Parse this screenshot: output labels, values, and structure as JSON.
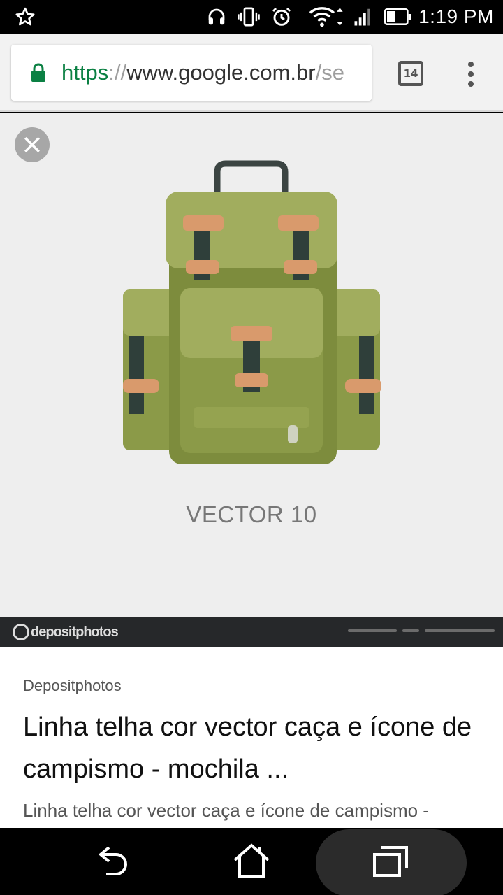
{
  "status_bar": {
    "time": "1:19 PM",
    "icons": [
      "star-icon",
      "headphones-icon",
      "vibrate-icon",
      "alarm-icon",
      "wifi-icon",
      "signal-icon",
      "battery-icon"
    ]
  },
  "toolbar": {
    "url_scheme": "https",
    "url_separator": "://",
    "url_host": "www.google.com.br",
    "url_path": "/se",
    "tab_count": "14"
  },
  "viewer": {
    "image_caption": "VECTOR 10",
    "watermark_brand": "depositphotos"
  },
  "result": {
    "source": "Depositphotos",
    "title": "Linha telha cor vector caça e ícone de campismo - mochila ...",
    "snippet": "Linha telha cor vector caça e ícone de campismo -"
  },
  "colors": {
    "backpack_main": "#8b9a48",
    "backpack_light": "#a1ad5e",
    "strap_tan": "#d99a6c",
    "strap_dark": "#2f3f3a",
    "secure_green": "#0b8043"
  }
}
